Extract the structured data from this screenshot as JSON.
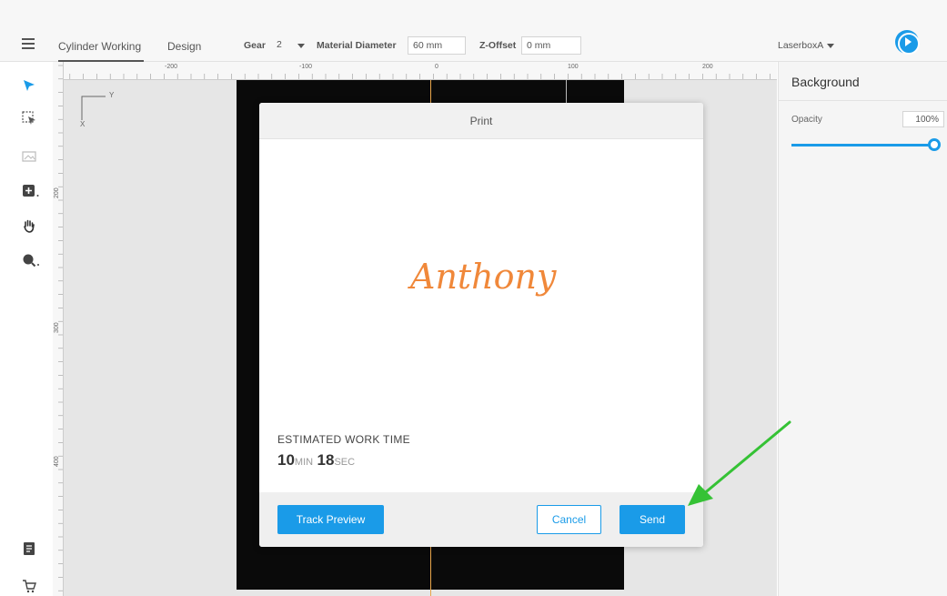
{
  "header": {
    "tabs": [
      "Cylinder Working",
      "Design"
    ],
    "gear_label": "Gear",
    "gear_value": "2",
    "material_diameter_label": "Material Diameter",
    "material_diameter_value": "60 mm",
    "z_offset_label": "Z-Offset",
    "z_offset_value": "0 mm",
    "device_name": "LaserboxA"
  },
  "ruler": {
    "h_labels": [
      "-200",
      "-100",
      "0",
      "100",
      "200"
    ],
    "v_labels": [
      "200",
      "300",
      "400"
    ]
  },
  "canvas": {
    "axis_y": "Y",
    "axis_x": "X"
  },
  "right_panel": {
    "title": "Background",
    "opacity_label": "Opacity",
    "opacity_value": "100%",
    "opacity_fraction": 1.0
  },
  "modal": {
    "title": "Print",
    "preview_text": "Anthony",
    "estimated_label": "ESTIMATED WORK TIME",
    "minutes": "10",
    "min_unit": "MIN",
    "seconds": "18",
    "sec_unit": "SEC",
    "track_preview": "Track Preview",
    "cancel": "Cancel",
    "send": "Send"
  },
  "colors": {
    "accent": "#1a9be8",
    "signature": "#f0883a",
    "annotation_arrow": "#35c235"
  },
  "icons": [
    "menu-icon",
    "select-arrow-icon",
    "select-area-icon",
    "image-icon",
    "add-shape-icon",
    "hand-icon",
    "zoom-icon",
    "document-icon",
    "cart-icon",
    "run-icon"
  ]
}
